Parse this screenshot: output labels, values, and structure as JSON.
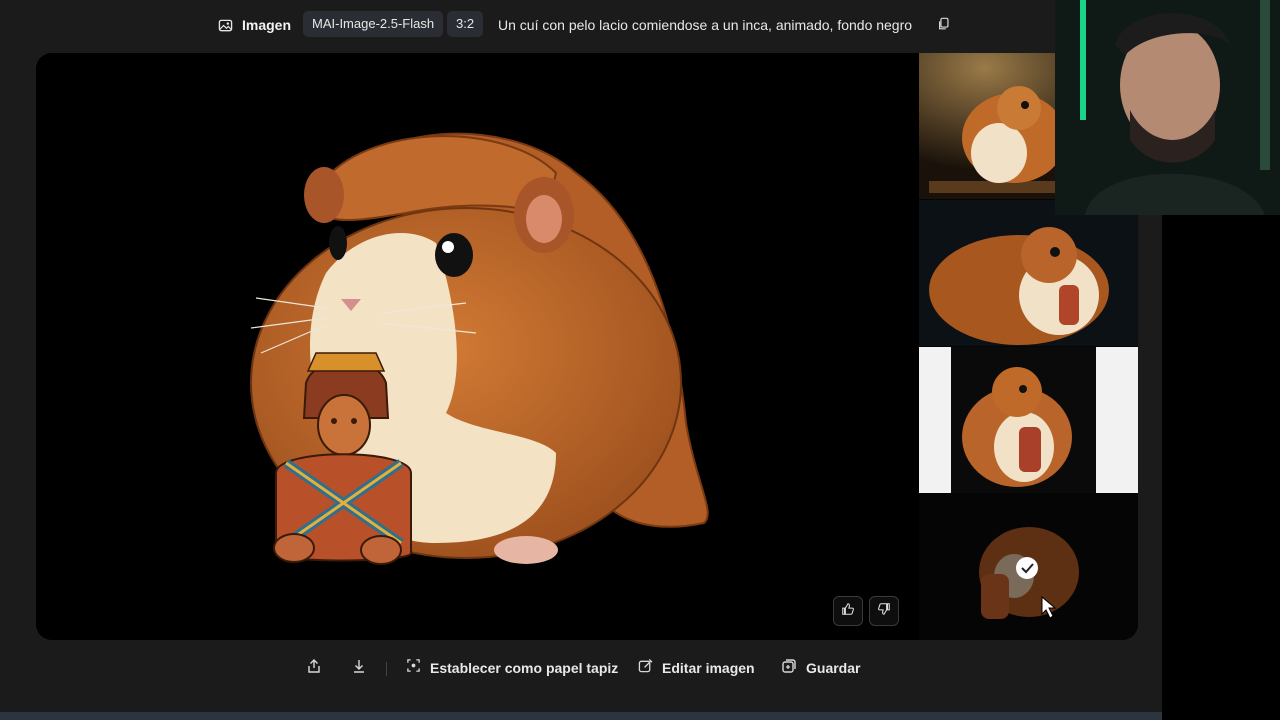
{
  "topbar": {
    "mode_icon": "image-icon",
    "mode_label": "Imagen",
    "model": "MAI-Image-2.5-Flash",
    "aspect_ratio": "3:2",
    "prompt": "Un cuí con pelo lacio comiendose a un inca, animado, fondo negro",
    "copy_icon": "copy-icon"
  },
  "viewer": {
    "main_image": "guinea-pig-with-long-straight-hair-holding-inca-figure",
    "feedback": {
      "like_icon": "thumbs-up-icon",
      "dislike_icon": "thumbs-down-icon"
    },
    "thumbnails": [
      {
        "image": "guinea-pig-thumbnail-1",
        "selected": false
      },
      {
        "image": "guinea-pig-thumbnail-2",
        "selected": false
      },
      {
        "image": "guinea-pig-thumbnail-3",
        "selected": false
      },
      {
        "image": "guinea-pig-thumbnail-4",
        "selected": true
      }
    ]
  },
  "actions": {
    "share_icon": "share-icon",
    "download_icon": "download-icon",
    "wallpaper_label": "Establecer como papel tapiz",
    "edit_label": "Editar imagen",
    "save_label": "Guardar"
  },
  "colors": {
    "background": "#1b1b1b",
    "chip": "#2a2d33",
    "fur": "#b8642a",
    "fur_light": "#f3e2c4"
  }
}
